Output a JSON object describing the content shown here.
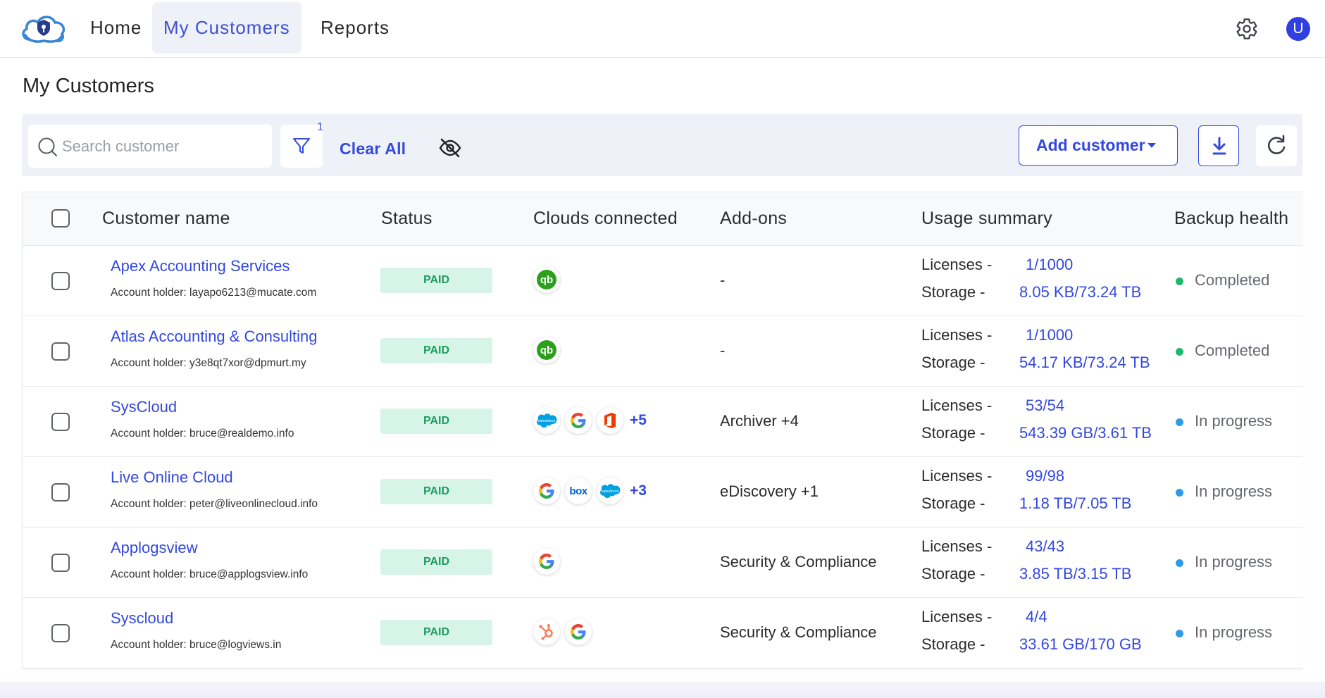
{
  "nav": {
    "tabs": [
      {
        "label": "Home"
      },
      {
        "label": "My Customers",
        "active": true
      },
      {
        "label": "Reports"
      }
    ],
    "avatar_initial": "U",
    "icons": {
      "logo": "cloud-shield-logo",
      "settings": "gear-icon"
    }
  },
  "page": {
    "title": "My Customers"
  },
  "toolbar": {
    "search_placeholder": "Search customer",
    "filter_count": "1",
    "clear_all_label": "Clear All",
    "add_customer_label": "Add customer"
  },
  "table": {
    "columns": [
      "Customer name",
      "Status",
      "Clouds connected",
      "Add-ons",
      "Usage summary",
      "Backup health"
    ],
    "licenses_label": "Licenses -",
    "storage_label": "Storage -",
    "rows": [
      {
        "name": "Apex Accounting Services",
        "holder": "Account holder: layapo6213@mucate.com",
        "status": "PAID",
        "clouds": [
          "quickbooks"
        ],
        "clouds_more": "",
        "addons": "-",
        "licenses": "1/1000",
        "storage": "8.05 KB/73.24 TB",
        "health": "Completed",
        "health_color": "#1eb869"
      },
      {
        "name": "Atlas Accounting & Consulting",
        "holder": "Account holder: y3e8qt7xor@dpmurt.my",
        "status": "PAID",
        "clouds": [
          "quickbooks"
        ],
        "clouds_more": "",
        "addons": "-",
        "licenses": "1/1000",
        "storage": "54.17 KB/73.24 TB",
        "health": "Completed",
        "health_color": "#1eb869"
      },
      {
        "name": "SysCloud",
        "holder": "Account holder: bruce@realdemo.info",
        "status": "PAID",
        "clouds": [
          "salesforce",
          "google",
          "office365"
        ],
        "clouds_more": "+5",
        "addons": "Archiver +4",
        "licenses": "53/54",
        "storage": "543.39 GB/3.61 TB",
        "health": "In progress",
        "health_color": "#2e9be6"
      },
      {
        "name": "Live Online Cloud",
        "holder": "Account holder: peter@liveonlinecloud.info",
        "status": "PAID",
        "clouds": [
          "google",
          "box",
          "salesforce"
        ],
        "clouds_more": "+3",
        "addons": "eDiscovery +1",
        "licenses": "99/98",
        "storage": "1.18 TB/7.05 TB",
        "health": "In progress",
        "health_color": "#2e9be6"
      },
      {
        "name": "Applogsview",
        "holder": "Account holder: bruce@applogsview.info",
        "status": "PAID",
        "clouds": [
          "google"
        ],
        "clouds_more": "",
        "addons": "Security & Compliance",
        "licenses": "43/43",
        "storage": "3.85 TB/3.15 TB",
        "health": "In progress",
        "health_color": "#2e9be6"
      },
      {
        "name": "Syscloud",
        "holder": "Account holder: bruce@logviews.in",
        "status": "PAID",
        "clouds": [
          "hubspot",
          "google"
        ],
        "clouds_more": "",
        "addons": "Security & Compliance",
        "licenses": "4/4",
        "storage": "33.61 GB/170 GB",
        "health": "In progress",
        "health_color": "#2e9be6"
      }
    ]
  },
  "colors": {
    "accent": "#3348e0",
    "paid_bg": "#d6f4e7",
    "paid_text": "#1c9d60"
  }
}
